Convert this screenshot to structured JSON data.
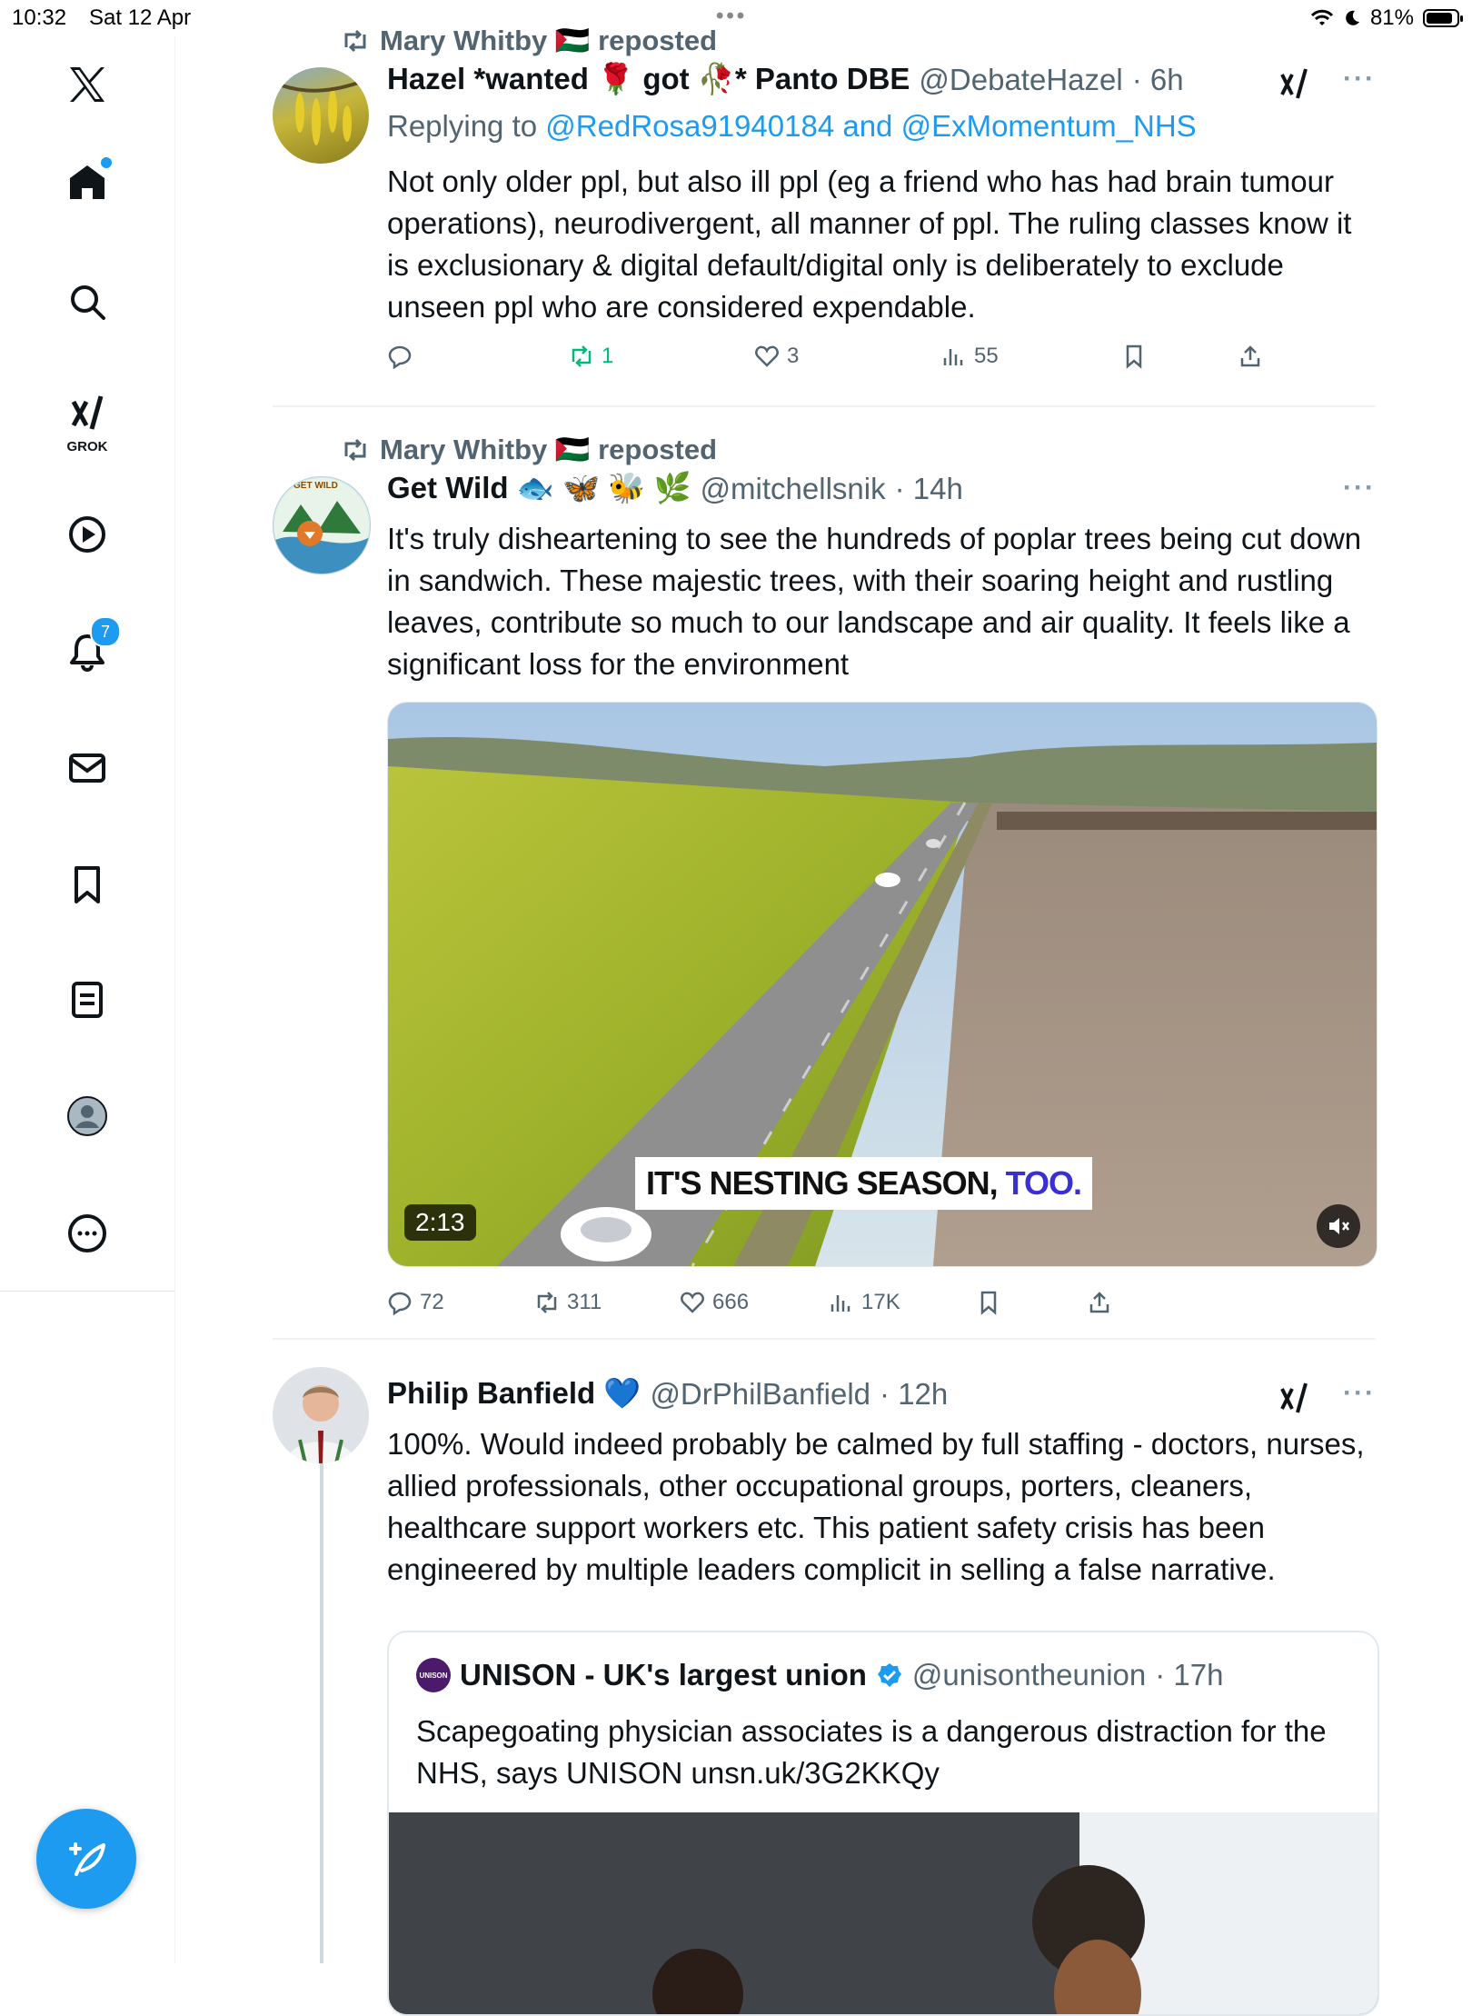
{
  "status_bar": {
    "time": "10:32",
    "date": "Sat 12 Apr",
    "battery": "81%",
    "battery_level": 0.81
  },
  "sidebar": {
    "grok_label": "GROK",
    "notifications_badge": "7",
    "items": [
      {
        "name": "x-logo-icon"
      },
      {
        "name": "home-icon"
      },
      {
        "name": "search-icon"
      },
      {
        "name": "grok-icon"
      },
      {
        "name": "video-play-icon"
      },
      {
        "name": "notifications-bell-icon"
      },
      {
        "name": "messages-mail-icon"
      },
      {
        "name": "bookmarks-icon"
      },
      {
        "name": "lists-icon"
      },
      {
        "name": "profile-avatar-icon"
      },
      {
        "name": "more-circle-icon"
      }
    ],
    "compose_icon": "compose-feather-icon"
  },
  "tweets": [
    {
      "repost_by": "Mary Whitby 🇵🇸 reposted",
      "display_name": "Hazel *wanted 🌹 got 🥀* Panto DBE",
      "handle": "@DebateHazel",
      "time": "· 6h",
      "replying_prefix": "Replying to",
      "replying_to": "@RedRosa91940184 and @ExMomentum_NHS",
      "text": "Not only older ppl, but also ill ppl (eg a friend who has had brain tumour operations), neurodivergent, all manner of ppl.  The ruling classes know it is exclusionary & digital default/digital only is deliberately to exclude unseen ppl who are considered expendable.",
      "stats": {
        "replies": "",
        "reposts": "1",
        "likes": "3",
        "views": "55"
      },
      "reposted_by_viewer": true
    },
    {
      "repost_by": "Mary Whitby 🇵🇸 reposted",
      "display_name": "Get Wild 🐟 🦋 🐝 🌿",
      "handle": "@mitchellsnik",
      "time": "· 14h",
      "text": "It's truly disheartening to see the hundreds of poplar trees being cut down in sandwich. These majestic trees, with their soaring height and rustling leaves, contribute so much to our landscape and air quality. It feels like a significant loss for the environment",
      "media": {
        "caption_main": "IT'S NESTING SEASON,",
        "caption_accent": " TOO.",
        "duration": "2:13"
      },
      "avatar_badge": "GET WILD",
      "stats": {
        "replies": "72",
        "reposts": "311",
        "likes": "666",
        "views": "17K"
      }
    },
    {
      "display_name": "Philip Banfield 💙",
      "handle": "@DrPhilBanfield",
      "time": "· 12h",
      "text": "100%. Would indeed probably be calmed by full staffing - doctors, nurses, allied professionals, other occupational groups, porters, cleaners, healthcare support workers etc. This patient safety crisis has been engineered by multiple leaders complicit in selling a false narrative.",
      "quote": {
        "display_name": "UNISON - UK's largest union",
        "handle": "@unisontheunion",
        "time": "· 17h",
        "avatar_text": "UNISON",
        "text": "Scapegoating physician associates is a dangerous distraction for the NHS, says UNISON unsn.uk/3G2KKQy"
      }
    }
  ],
  "colors": {
    "accent": "#1d9bf0",
    "repost_green": "#00ba7c",
    "secondary_text": "#536471"
  }
}
